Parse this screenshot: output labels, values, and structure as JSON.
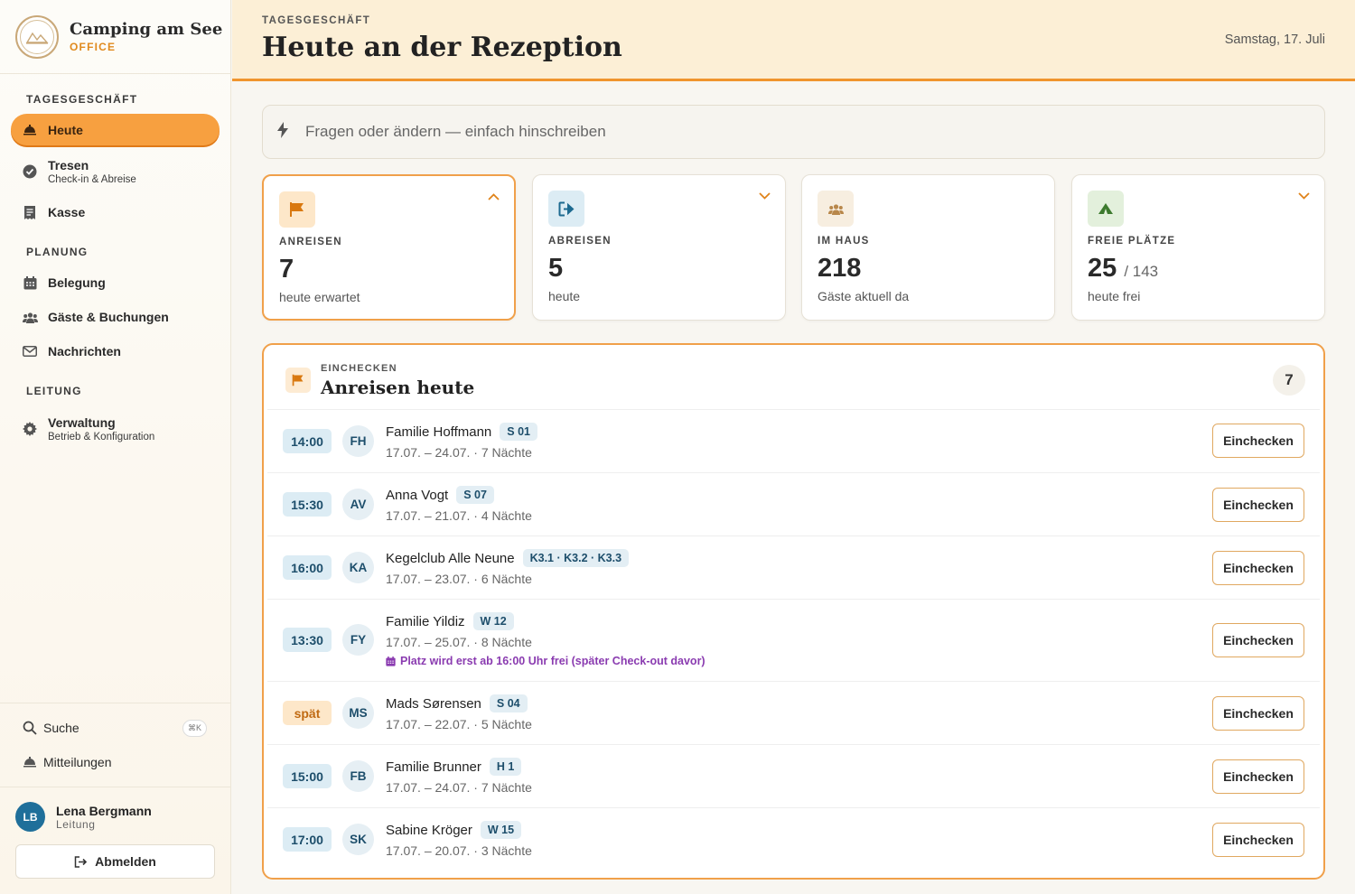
{
  "app": {
    "name": "Camping am See",
    "sub": "OFFICE"
  },
  "sidebar": {
    "sections": [
      "TAGESGESCHÄFT",
      "PLANUNG",
      "LEITUNG"
    ],
    "items": [
      {
        "label": "Heute",
        "sub": "",
        "icon": "bell-icon",
        "active": true
      },
      {
        "label": "Tresen",
        "sub": "Check-in & Abreise",
        "icon": "check-circle-icon"
      },
      {
        "label": "Kasse",
        "sub": "",
        "icon": "receipt-icon"
      },
      {
        "label": "Belegung",
        "sub": "",
        "icon": "calendar-icon"
      },
      {
        "label": "Gäste & Buchungen",
        "sub": "",
        "icon": "users-icon"
      },
      {
        "label": "Nachrichten",
        "sub": "",
        "icon": "mail-icon"
      },
      {
        "label": "Verwaltung",
        "sub": "Betrieb & Konfiguration",
        "icon": "gear-icon"
      }
    ],
    "search": {
      "label": "Suche",
      "shortcut": "⌘K"
    },
    "notifications": {
      "label": "Mitteilungen"
    },
    "user": {
      "initials": "LB",
      "name": "Lena Bergmann",
      "role": "Leitung"
    },
    "logout": "Abmelden"
  },
  "header": {
    "eyebrow": "TAGESGESCHÄFT",
    "title": "Heute an der Rezeption",
    "date": "Samstag, 17. Juli"
  },
  "command": {
    "placeholder": "Fragen oder ändern — einfach hinschreiben"
  },
  "stats": [
    {
      "label": "ANREISEN",
      "value": "7",
      "of": "",
      "note": "heute erwartet",
      "chevron": "⌃",
      "color": "#e0831a"
    },
    {
      "label": "ABREISEN",
      "value": "5",
      "of": "",
      "note": "heute",
      "chevron": "⌄",
      "color": "#1d6a90"
    },
    {
      "label": "IM HAUS",
      "value": "218",
      "of": "",
      "note": "Gäste aktuell da",
      "chevron": "",
      "color": "#b8874a"
    },
    {
      "label": "FREIE PLÄTZE",
      "value": "25",
      "of": "/ 143",
      "note": "heute frei",
      "chevron": "⌄",
      "color": "#3d7a2e"
    }
  ],
  "arrivals": {
    "eyebrow": "EINCHECKEN",
    "title": "Anreisen heute",
    "count": "7",
    "button": "Einchecken",
    "rows": [
      {
        "time": "14:00",
        "initials": "FH",
        "name": "Familie Hoffmann",
        "pitch": "S 01",
        "dates": "17.07. – 24.07. · 7 Nächte",
        "warning": ""
      },
      {
        "time": "15:30",
        "initials": "AV",
        "name": "Anna Vogt",
        "pitch": "S 07",
        "dates": "17.07. – 21.07. · 4 Nächte",
        "warning": ""
      },
      {
        "time": "16:00",
        "initials": "KA",
        "name": "Kegelclub Alle Neune",
        "pitch": "K3.1 · K3.2 · K3.3",
        "dates": "17.07. – 23.07. · 6 Nächte",
        "warning": ""
      },
      {
        "time": "13:30",
        "initials": "FY",
        "name": "Familie Yildiz",
        "pitch": "W 12",
        "dates": "17.07. – 25.07. · 8 Nächte",
        "warning": "Platz wird erst ab 16:00 Uhr frei (später Check-out davor)"
      },
      {
        "time": "spät",
        "initials": "MS",
        "name": "Mads Sørensen",
        "pitch": "S 04",
        "dates": "17.07. – 22.07. · 5 Nächte",
        "warning": ""
      },
      {
        "time": "15:00",
        "initials": "FB",
        "name": "Familie Brunner",
        "pitch": "H 1",
        "dates": "17.07. – 24.07. · 7 Nächte",
        "warning": ""
      },
      {
        "time": "17:00",
        "initials": "SK",
        "name": "Sabine Kröger",
        "pitch": "W 15",
        "dates": "17.07. – 20.07. · 3 Nächte",
        "warning": ""
      }
    ]
  }
}
